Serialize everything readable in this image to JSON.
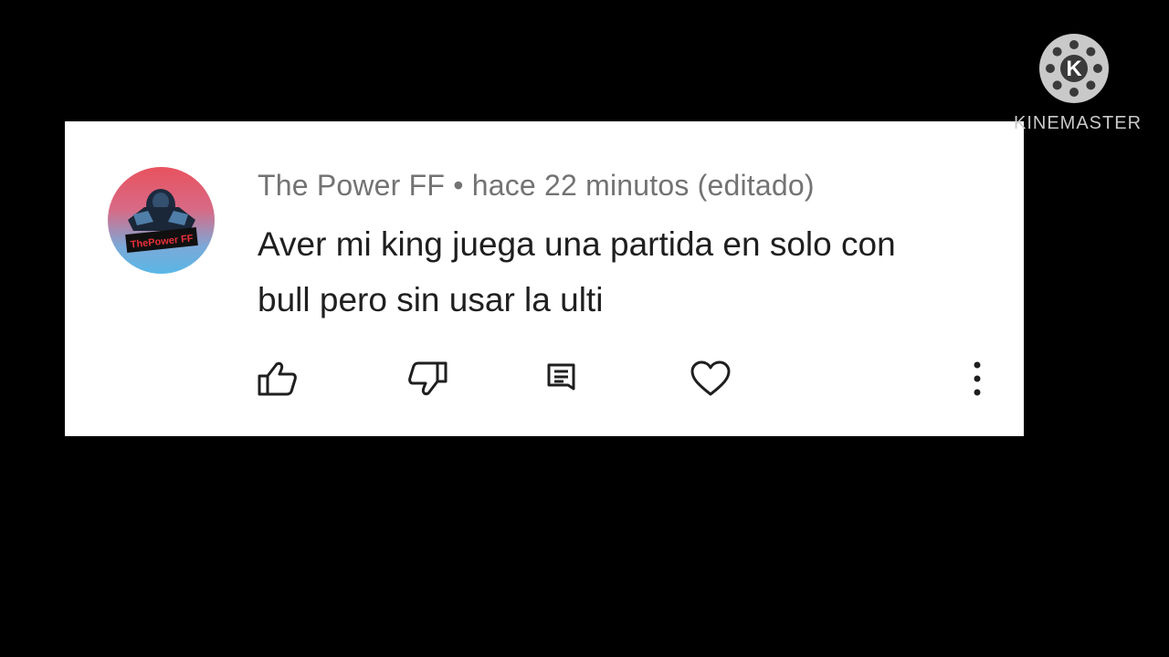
{
  "comment": {
    "author": "The Power FF",
    "separator": "•",
    "time": "hace 22 minutos",
    "edited": "(editado)",
    "text_line1": "Aver mi king juega una partida en solo con",
    "text_line2": "bull pero sin usar la ulti",
    "avatar_label": "ThePower FF"
  },
  "actions": {
    "like_icon": "thumbs-up-icon",
    "dislike_icon": "thumbs-down-icon",
    "reply_icon": "comment-icon",
    "heart_icon": "heart-icon",
    "more_icon": "more-vertical-icon"
  },
  "watermark": {
    "logo_letter": "K",
    "brand": "KINEMASTER"
  },
  "colors": {
    "background": "#000000",
    "card": "#ffffff",
    "meta_text": "#737373",
    "body_text": "#1f1f1f",
    "icon": "#1f1f1f",
    "watermark": "#c9c9c9"
  }
}
